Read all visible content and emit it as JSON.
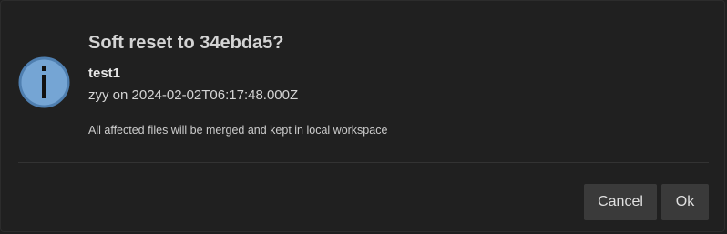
{
  "dialog": {
    "icon": "info-icon",
    "title": "Soft reset to 34ebda5?",
    "commit_message": "test1",
    "author_line": "zyy on 2024-02-02T06:17:48.000Z",
    "note": "All affected files will be merged and kept in local workspace",
    "buttons": {
      "cancel_label": "Cancel",
      "ok_label": "Ok"
    }
  },
  "colors": {
    "background": "#202020",
    "icon_fill": "#75a5d4",
    "icon_border": "#4f7fb0",
    "button_bg": "#3a3a3a",
    "text": "#cccccc"
  }
}
